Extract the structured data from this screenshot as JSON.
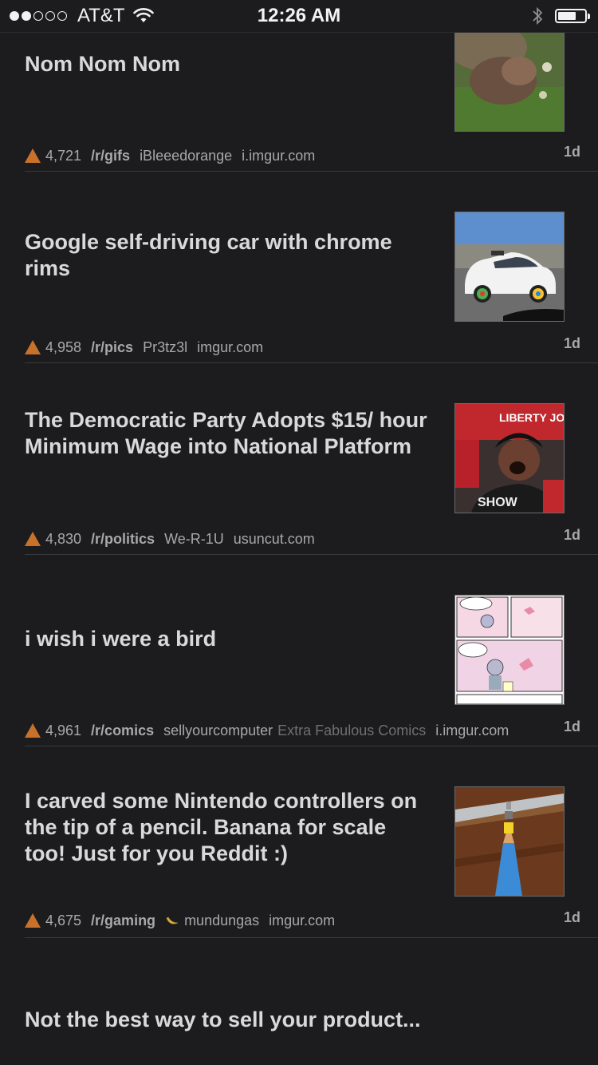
{
  "status_bar": {
    "carrier": "AT&T",
    "time": "12:26 AM",
    "signal_bars_filled": 2,
    "signal_bars_total": 5,
    "battery_level": 0.7
  },
  "posts": [
    {
      "title": "Nom Nom Nom",
      "score": "4,721",
      "subreddit": "/r/gifs",
      "author": "iBleeedorange",
      "domain": "i.imgur.com",
      "age": "1d",
      "thumbnail": "hamster-icon"
    },
    {
      "title": "Google self-driving car with chrome rims",
      "score": "4,958",
      "subreddit": "/r/pics",
      "author": "Pr3tz3l",
      "domain": "imgur.com",
      "age": "1d",
      "thumbnail": "self-driving-car-icon"
    },
    {
      "title": "The Democratic Party Adopts $15/ hour Minimum Wage into National Platform",
      "score": "4,830",
      "subreddit": "/r/politics",
      "author": "We-R-1U",
      "domain": "usuncut.com",
      "age": "1d",
      "thumbnail": "protester-icon"
    },
    {
      "title": "i wish i were a bird",
      "score": "4,961",
      "subreddit": "/r/comics",
      "author": "sellyourcomputer",
      "flair": "Extra Fabulous Comics",
      "domain": "i.imgur.com",
      "age": "1d",
      "thumbnail": "comic-icon"
    },
    {
      "title": "I carved some Nintendo controllers on the tip of a pencil. Banana for scale too! Just for you Reddit :)",
      "score": "4,675",
      "subreddit": "/r/gaming",
      "author": "mundungas",
      "domain": "imgur.com",
      "age": "1d",
      "thumbnail": "pencil-icon"
    },
    {
      "title": "Not the best way to sell your product..."
    }
  ]
}
